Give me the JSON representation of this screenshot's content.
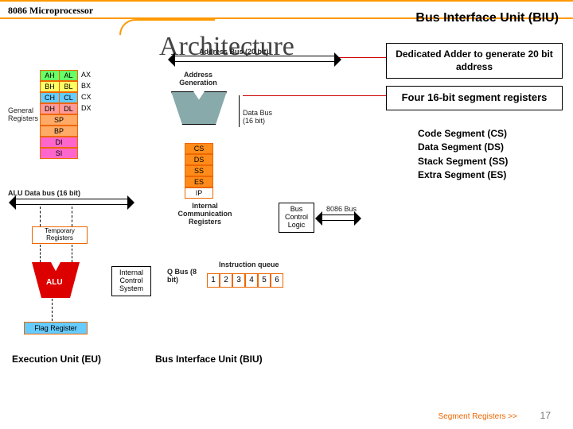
{
  "header": {
    "breadcrumb": "8086 Microprocessor",
    "biu_title": "Bus Interface Unit (BIU)"
  },
  "section_title": "Architecture",
  "callouts": {
    "adder": "Dedicated Adder to generate 20 bit address",
    "segreg": "Four 16-bit segment registers",
    "seg_list": [
      "Code Segment (CS)",
      "Data Segment (DS)",
      "Stack Segment (SS)",
      "Extra Segment (ES)"
    ]
  },
  "footer": {
    "link": "Segment Registers >>",
    "page": "17"
  },
  "diagram": {
    "labels": {
      "address_bus": "Address Bus (20 bit)",
      "general_registers": "General Registers",
      "address_generation": "Address Generation",
      "data_bus": "Data Bus (16 bit)",
      "alu_data_bus": "ALU Data bus (16 bit)",
      "internal_comm": "Internal Communication Registers",
      "bus_control": "Bus Control Logic",
      "ext_bus": "8086 Bus",
      "internal_ctrl": "Internal Control System",
      "q_bus": "Q Bus (8 bit)",
      "instruction_queue": "Instruction queue",
      "temporary": "Temporary Registers",
      "alu": "ALU",
      "flag": "Flag Register",
      "eu_caption": "Execution Unit (EU)",
      "biu_caption": "Bus Interface Unit (BIU)"
    },
    "gen_reg_pairs": [
      {
        "h": "AH",
        "l": "AL",
        "x": "AX"
      },
      {
        "h": "BH",
        "l": "BL",
        "x": "BX"
      },
      {
        "h": "CH",
        "l": "CL",
        "x": "CX"
      },
      {
        "h": "DH",
        "l": "DL",
        "x": "DX"
      }
    ],
    "pointer_index_regs": [
      "SP",
      "BP",
      "DI",
      "SI"
    ],
    "segment_regs": [
      "CS",
      "DS",
      "SS",
      "ES",
      "IP"
    ],
    "queue_cells": [
      "1",
      "2",
      "3",
      "4",
      "5",
      "6"
    ]
  }
}
